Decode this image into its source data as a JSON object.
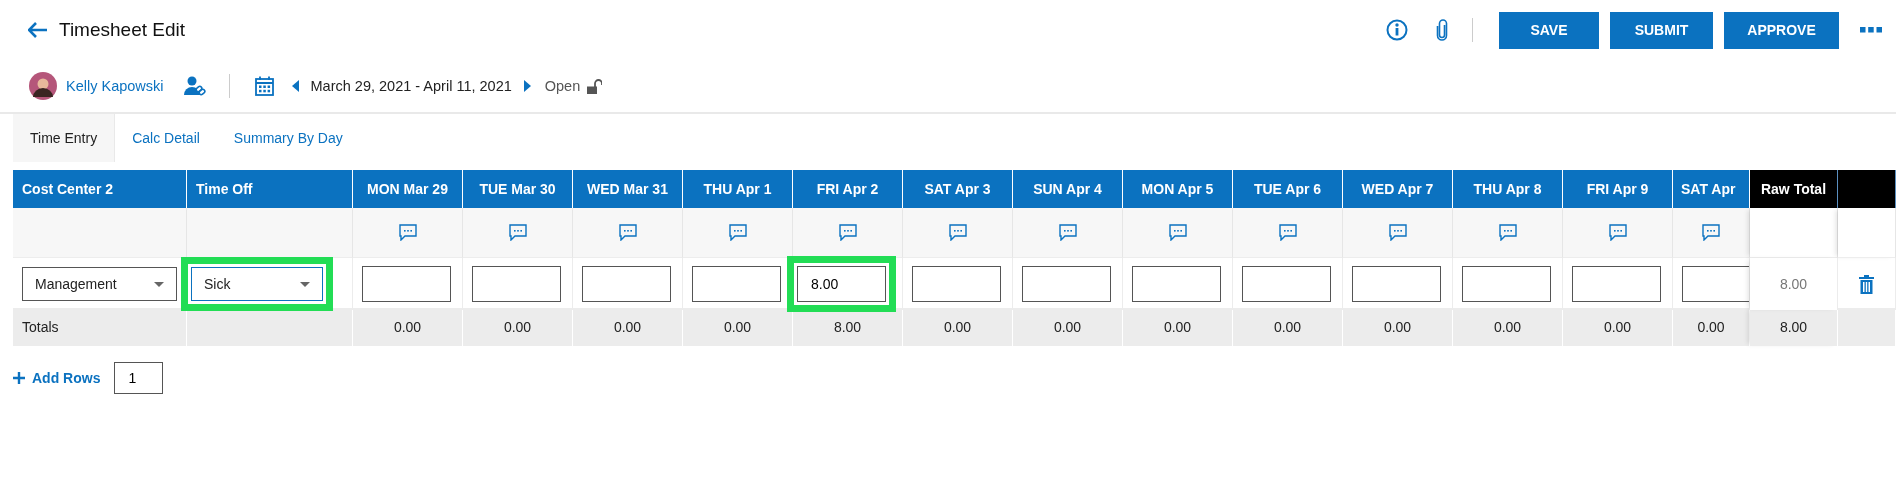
{
  "page": {
    "title": "Timesheet Edit"
  },
  "actions": [
    "SAVE",
    "SUBMIT",
    "APPROVE"
  ],
  "employee": {
    "name": "Kelly Kapowski"
  },
  "period": {
    "range": "March 29, 2021 - April 11, 2021",
    "status": "Open",
    "locked": false
  },
  "tabs": [
    {
      "label": "Time Entry",
      "selected": true
    },
    {
      "label": "Calc Detail",
      "selected": false
    },
    {
      "label": "Summary By Day",
      "selected": false
    }
  ],
  "table": {
    "columns": [
      {
        "label": "Cost Center 2",
        "kind": "text"
      },
      {
        "label": "Time Off",
        "kind": "text"
      },
      {
        "label": "MON Mar 29",
        "kind": "day"
      },
      {
        "label": "TUE Mar 30",
        "kind": "day"
      },
      {
        "label": "WED Mar 31",
        "kind": "day"
      },
      {
        "label": "THU Apr 1",
        "kind": "day"
      },
      {
        "label": "FRI Apr 2",
        "kind": "day"
      },
      {
        "label": "SAT Apr 3",
        "kind": "day"
      },
      {
        "label": "SUN Apr 4",
        "kind": "day"
      },
      {
        "label": "MON Apr 5",
        "kind": "day"
      },
      {
        "label": "TUE Apr 6",
        "kind": "day"
      },
      {
        "label": "WED Apr 7",
        "kind": "day"
      },
      {
        "label": "THU Apr 8",
        "kind": "day"
      },
      {
        "label": "FRI Apr 9",
        "kind": "day"
      },
      {
        "label": "SAT Apr",
        "kind": "day"
      },
      {
        "label": "Raw Total",
        "kind": "total"
      },
      {
        "kind": "action"
      }
    ],
    "entry_row": {
      "cost_center": {
        "value": "Management",
        "highlighted": false
      },
      "time_off": {
        "value": "Sick",
        "highlighted": true
      },
      "days": [
        {
          "highlighted": false
        },
        {
          "highlighted": false
        },
        {
          "highlighted": false
        },
        {
          "highlighted": false
        },
        {
          "value": "8.00",
          "highlighted": true
        },
        {
          "highlighted": false
        },
        {
          "highlighted": false
        },
        {
          "highlighted": false
        },
        {
          "highlighted": false
        },
        {
          "highlighted": false
        },
        {
          "highlighted": false
        },
        {
          "highlighted": false
        },
        {
          "highlighted": false
        }
      ],
      "raw_total": "8.00"
    },
    "totals_row": {
      "label": "Totals",
      "values": [
        "0.00",
        "0.00",
        "0.00",
        "0.00",
        "8.00",
        "0.00",
        "0.00",
        "0.00",
        "0.00",
        "0.00",
        "0.00",
        "0.00",
        "0.00"
      ],
      "raw_total": "8.00"
    }
  },
  "add_rows": {
    "label": "Add Rows",
    "count": "1"
  }
}
